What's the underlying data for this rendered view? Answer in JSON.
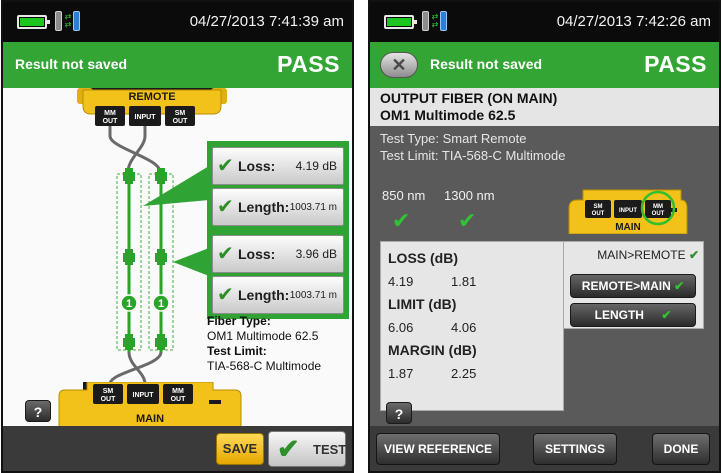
{
  "left_screen": {
    "datetime": "04/27/2013 7:41:39 am",
    "result_status": "Result not saved",
    "pass_label": "PASS",
    "remote_unit": {
      "title": "REMOTE",
      "ports": [
        "MM OUT",
        "INPUT",
        "SM OUT"
      ]
    },
    "main_unit": {
      "title": "MAIN",
      "ports": [
        "SM OUT",
        "INPUT",
        "MM OUT"
      ]
    },
    "fiber_markers": [
      "1",
      "1"
    ],
    "upper_result": {
      "loss_label": "Loss:",
      "loss_value": "4.19 dB",
      "length_label": "Length:",
      "length_value": "1003.71 m"
    },
    "lower_result": {
      "loss_label": "Loss:",
      "loss_value": "3.96 dB",
      "length_label": "Length:",
      "length_value": "1003.71 m"
    },
    "fiber_type_label": "Fiber Type:",
    "fiber_type_value": "OM1 Multimode 62.5",
    "test_limit_label": "Test Limit:",
    "test_limit_value": "TIA-568-C Multimode",
    "help_label": "?",
    "save_label": "SAVE",
    "test_label": "TEST"
  },
  "right_screen": {
    "datetime": "04/27/2013 7:42:26 am",
    "result_status": "Result not saved",
    "pass_label": "PASS",
    "heading_line1": "OUTPUT FIBER (ON MAIN)",
    "heading_line2": "OM1 Multimode 62.5",
    "test_type": "Test Type: Smart Remote",
    "test_limit": "Test Limit: TIA-568-C Multimode",
    "wavelengths": [
      "850 nm",
      "1300 nm"
    ],
    "main_unit": {
      "title": "MAIN",
      "ports": [
        "SM OUT",
        "INPUT",
        "MM OUT"
      ],
      "highlighted_port": "MM OUT"
    },
    "table": {
      "loss_header": "LOSS (dB)",
      "loss_values": [
        "4.19",
        "1.81"
      ],
      "limit_header": "LIMIT (dB)",
      "limit_values": [
        "6.06",
        "4.06"
      ],
      "margin_header": "MARGIN (dB)",
      "margin_values": [
        "1.87",
        "2.25"
      ]
    },
    "direction_selected": "MAIN>REMOTE",
    "direction_buttons": [
      "REMOTE>MAIN",
      "LENGTH"
    ],
    "help_label": "?",
    "bottom_buttons": [
      "VIEW REFERENCE",
      "SETTINGS",
      "DONE"
    ]
  },
  "colors": {
    "pass_green": "#33a534",
    "fiber_green": "#28a428",
    "unit_yellow": "#f2c21a",
    "status_black": "#0b0b0b",
    "panel_gray": "#5a5a5a"
  }
}
